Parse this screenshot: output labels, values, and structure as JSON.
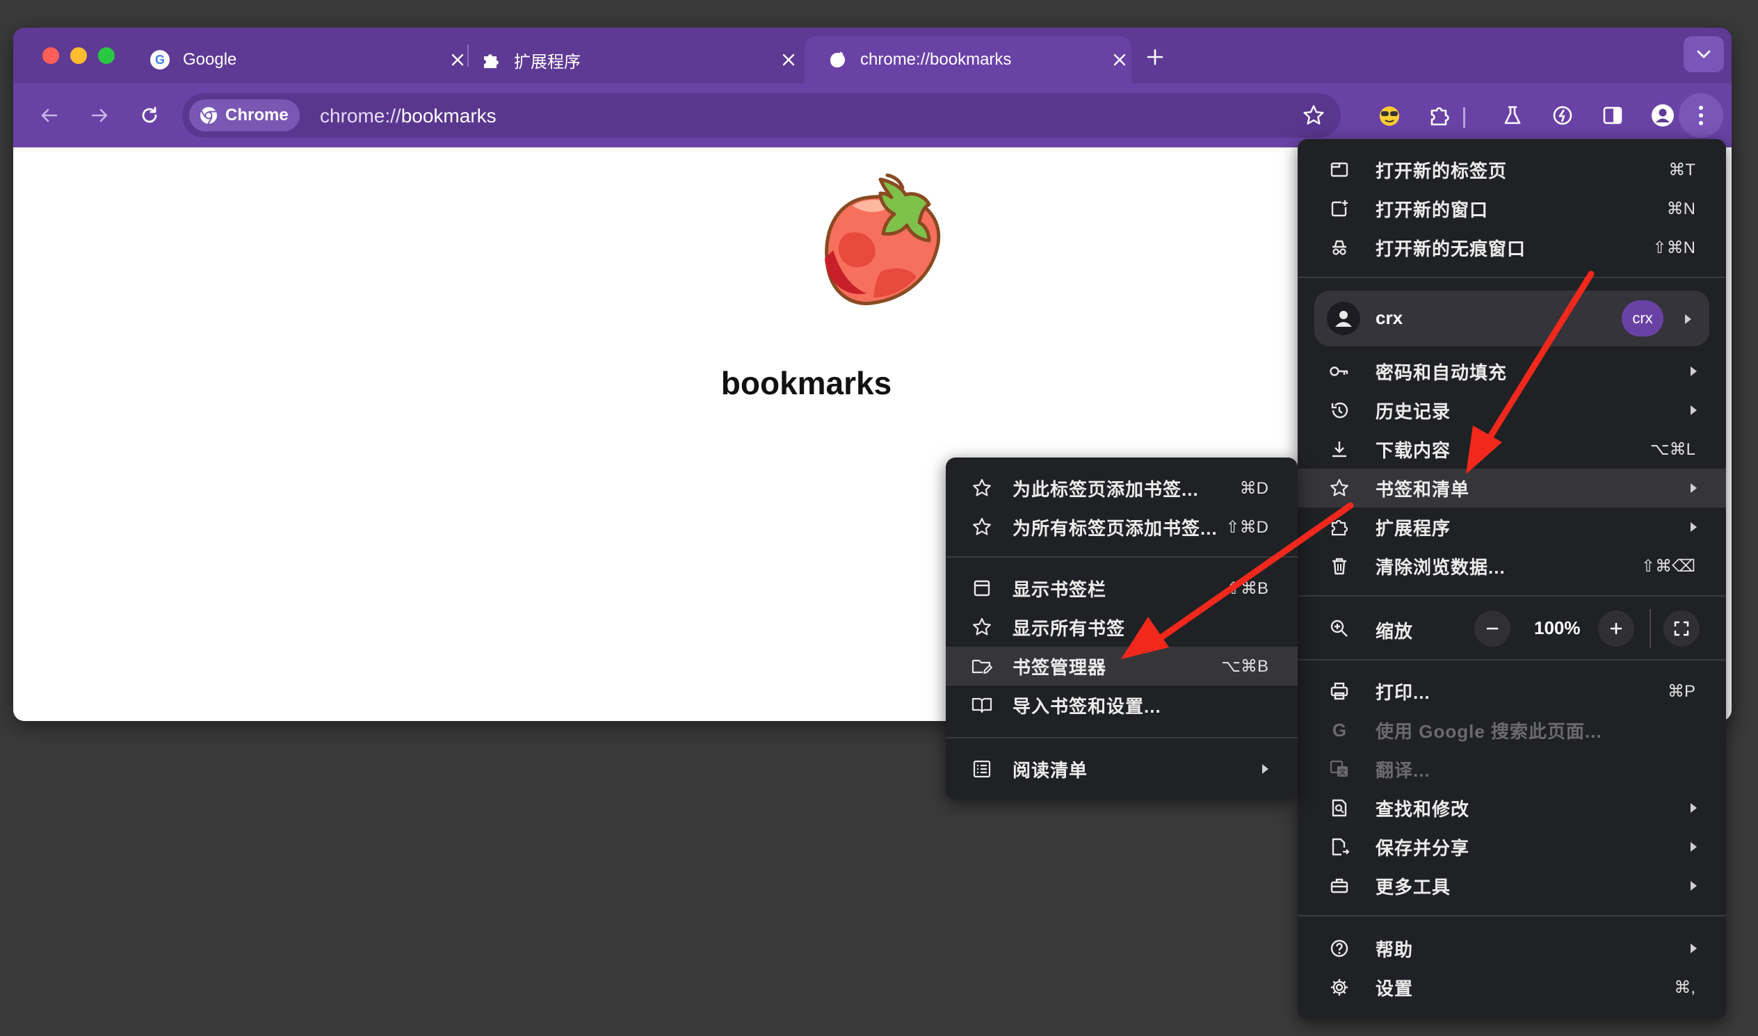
{
  "tabs": [
    {
      "title": "Google",
      "favicon": "google-g-icon"
    },
    {
      "title": "扩展程序",
      "favicon": "puzzle-icon"
    },
    {
      "title": "chrome://bookmarks",
      "favicon": "strawberry-icon",
      "active": true
    }
  ],
  "omnibox": {
    "chip": "Chrome",
    "url_scheme": "chrome://",
    "url_host": "bookmarks"
  },
  "page": {
    "heading": "bookmarks"
  },
  "main_menu": {
    "items_top": [
      {
        "label": "打开新的标签页",
        "shortcut": "⌘T",
        "icon": "new-tab-icon"
      },
      {
        "label": "打开新的窗口",
        "shortcut": "⌘N",
        "icon": "new-window-icon"
      },
      {
        "label": "打开新的无痕窗口",
        "shortcut": "⇧⌘N",
        "icon": "incognito-icon"
      }
    ],
    "profile": {
      "name": "crx",
      "badge": "crx"
    },
    "items_mid": [
      {
        "label": "密码和自动填充",
        "icon": "key-icon",
        "submenu": true
      },
      {
        "label": "历史记录",
        "icon": "history-icon",
        "submenu": true
      },
      {
        "label": "下载内容",
        "shortcut": "⌥⌘L",
        "icon": "download-icon"
      },
      {
        "label": "书签和清单",
        "icon": "star-icon",
        "submenu": true,
        "highlighted": true
      },
      {
        "label": "扩展程序",
        "icon": "puzzle-icon",
        "submenu": true
      },
      {
        "label": "清除浏览数据...",
        "shortcut": "⇧⌘⌫",
        "icon": "trash-icon"
      }
    ],
    "zoom": {
      "label": "缩放",
      "value": "100%",
      "minus": "−",
      "plus": "+"
    },
    "items_bottom": [
      {
        "label": "打印...",
        "shortcut": "⌘P",
        "icon": "printer-icon"
      },
      {
        "label": "使用 Google 搜索此页面...",
        "icon": "google-g-icon",
        "disabled": true
      },
      {
        "label": "翻译...",
        "icon": "translate-icon",
        "disabled": true
      },
      {
        "label": "查找和修改",
        "icon": "find-icon",
        "submenu": true
      },
      {
        "label": "保存并分享",
        "icon": "save-share-icon",
        "submenu": true
      },
      {
        "label": "更多工具",
        "icon": "toolbox-icon",
        "submenu": true
      }
    ],
    "items_help": [
      {
        "label": "帮助",
        "icon": "help-icon",
        "submenu": true
      },
      {
        "label": "设置",
        "shortcut": "⌘,",
        "icon": "gear-icon"
      }
    ]
  },
  "sub_menu": {
    "items_add": [
      {
        "label": "为此标签页添加书签...",
        "shortcut": "⌘D",
        "icon": "star-icon"
      },
      {
        "label": "为所有标签页添加书签...",
        "shortcut": "⇧⌘D",
        "icon": "star-icon"
      }
    ],
    "items_show": [
      {
        "label": "显示书签栏",
        "shortcut": "⇧⌘B",
        "icon": "bookmark-bar-icon"
      },
      {
        "label": "显示所有书签",
        "icon": "star-icon"
      },
      {
        "label": "书签管理器",
        "shortcut": "⌥⌘B",
        "icon": "folder-edit-icon",
        "highlighted": true
      },
      {
        "label": "导入书签和设置...",
        "icon": "book-icon"
      }
    ],
    "items_reading": [
      {
        "label": "阅读清单",
        "icon": "reading-list-icon",
        "submenu": true
      }
    ]
  },
  "colors": {
    "frame": "#5e3a94",
    "toolbar": "#6a42a6",
    "menu_bg": "#202124",
    "menu_highlight": "#36363a",
    "annotation_arrow": "#f2281c"
  }
}
